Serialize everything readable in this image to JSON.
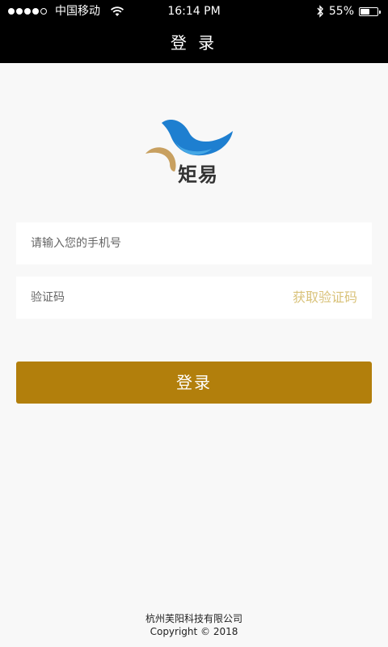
{
  "status_bar": {
    "carrier": "中国移动",
    "time": "16:14 PM",
    "battery_percent": "55%",
    "battery_level": 0.55,
    "signal_bars_filled": 4,
    "signal_bars_total": 5
  },
  "nav": {
    "title": "登 录"
  },
  "logo": {
    "text": "矩易",
    "colors": {
      "blue": "#1e7fd0",
      "gold": "#c8a060"
    }
  },
  "form": {
    "phone_placeholder": "请输入您的手机号",
    "code_placeholder": "验证码",
    "get_code_label": "获取验证码",
    "login_label": "登录"
  },
  "footer": {
    "company": "杭州芙阳科技有限公司",
    "copyright": "Copyright © 2018"
  },
  "colors": {
    "accent": "#b27f0c",
    "get_code_text": "#d9c27a",
    "background": "#f8f8f8"
  }
}
